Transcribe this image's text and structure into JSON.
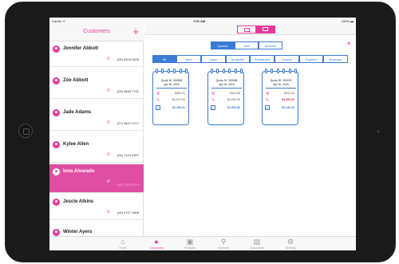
{
  "status": {
    "carrier": "Carrier ᯤ",
    "time": "7:01 AM",
    "battery": "100% ▬"
  },
  "customers": {
    "title": "Customers",
    "add": "+",
    "items": [
      {
        "name": "Jennifer Abbott",
        "phone": "(05) 8203 2825"
      },
      {
        "name": "Zoe Abbott",
        "phone": "(09) 9880 7721"
      },
      {
        "name": "Jade Adams",
        "phone": "(07) 3847 0717"
      },
      {
        "name": "Kylee Allen",
        "phone": "(04) 7143 9307"
      },
      {
        "name": "Iona Alvarado",
        "phone": "(02) 7374 2374",
        "selected": true
      },
      {
        "name": "Jescie Atkins",
        "phone": "(09) 2707 1808"
      },
      {
        "name": "Winter Ayers",
        "phone": ""
      }
    ]
  },
  "segments": [
    "Quotes",
    "Jobs",
    "Invoices"
  ],
  "filters": [
    "All",
    "Sent",
    "Open",
    "Accepted",
    "Scheduled",
    "Closed",
    "Expired",
    "Rejected"
  ],
  "quotes": [
    {
      "id": "Quote ID: 300069",
      "date": "Apr 30, 2015",
      "a1": "$869.31",
      "a2": "$1,570.00",
      "total": "$2,439.31"
    },
    {
      "id": "Quote ID: 300068",
      "date": "Apr 26, 2015",
      "a1": "$344.86",
      "a2": "$2,252.00",
      "total": "$2,596.86"
    },
    {
      "id": "Quote ID: 300076",
      "date": "Apr 30, 2015",
      "a1": "$332.26",
      "a2": "$4,900.00",
      "total": "$5,232.26"
    }
  ],
  "tabs": [
    "Home",
    "Customers",
    "Products",
    "Services",
    "Documents",
    "Settings"
  ],
  "colors": {
    "accent": "#e8399b",
    "blue": "#3a7bd5"
  }
}
